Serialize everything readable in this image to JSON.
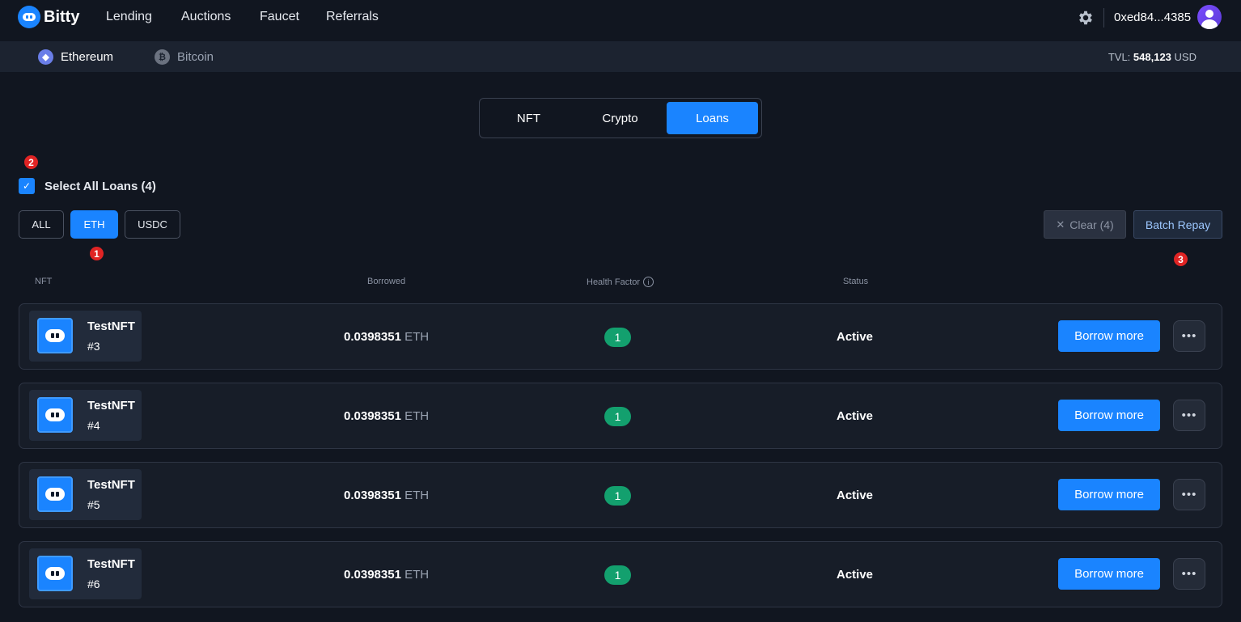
{
  "app": {
    "name": "Bitty"
  },
  "nav": {
    "links": [
      "Lending",
      "Auctions",
      "Faucet",
      "Referrals"
    ],
    "address": "0xed84...4385"
  },
  "chains": [
    {
      "label": "Ethereum",
      "icon": "ethereum-icon"
    },
    {
      "label": "Bitcoin",
      "icon": "bitcoin-icon",
      "glyph": "₿"
    }
  ],
  "tvl": {
    "label": "TVL:",
    "value": "548,123",
    "unit": "USD"
  },
  "segment": {
    "tabs": [
      "NFT",
      "Crypto",
      "Loans"
    ],
    "active": "Loans"
  },
  "markers": [
    "1",
    "2",
    "3"
  ],
  "select_all": {
    "label": "Select All Loans (4)",
    "checked": true
  },
  "filters": {
    "items": [
      "ALL",
      "ETH",
      "USDC"
    ],
    "active": "ETH"
  },
  "actions": {
    "clear": "Clear (4)",
    "clear_icon": "✕",
    "batch_repay": "Batch Repay"
  },
  "columns": {
    "nft": "NFT",
    "borrowed": "Borrowed",
    "health": "Health Factor",
    "status": "Status"
  },
  "loans": [
    {
      "name": "TestNFT",
      "id": "#3",
      "amount": "0.0398351",
      "unit": "ETH",
      "health": "1",
      "status": "Active",
      "action": "Borrow more",
      "more": "•••"
    },
    {
      "name": "TestNFT",
      "id": "#4",
      "amount": "0.0398351",
      "unit": "ETH",
      "health": "1",
      "status": "Active",
      "action": "Borrow more",
      "more": "•••"
    },
    {
      "name": "TestNFT",
      "id": "#5",
      "amount": "0.0398351",
      "unit": "ETH",
      "health": "1",
      "status": "Active",
      "action": "Borrow more",
      "more": "•••"
    },
    {
      "name": "TestNFT",
      "id": "#6",
      "amount": "0.0398351",
      "unit": "ETH",
      "health": "1",
      "status": "Active",
      "action": "Borrow more",
      "more": "•••"
    }
  ],
  "colors": {
    "accent": "#1a84ff",
    "background": "#111620",
    "health_ok": "#13a06e",
    "marker": "#e02424"
  }
}
